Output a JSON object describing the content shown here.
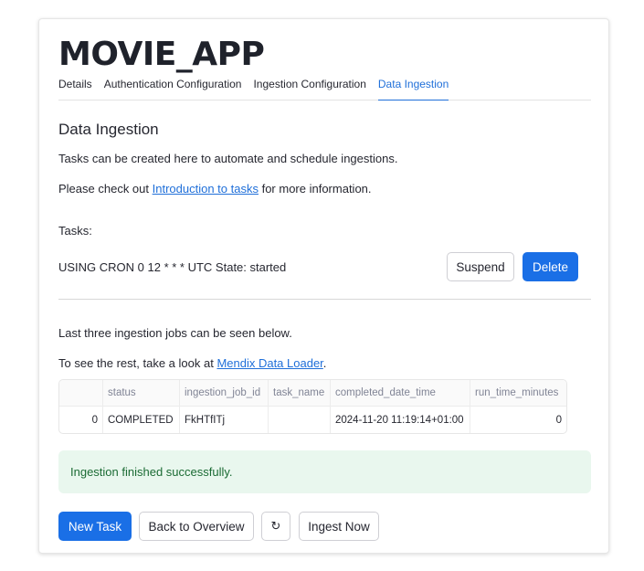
{
  "app": {
    "title": "MOVIE_APP"
  },
  "tabs": [
    {
      "label": "Details"
    },
    {
      "label": "Authentication Configuration"
    },
    {
      "label": "Ingestion Configuration"
    },
    {
      "label": "Data Ingestion",
      "active": true
    }
  ],
  "section": {
    "title": "Data Ingestion",
    "intro": "Tasks can be created here to automate and schedule ingestions.",
    "check_prefix": "Please check out ",
    "check_link": "Introduction to tasks",
    "check_suffix": " for more information."
  },
  "tasks": {
    "label": "Tasks:",
    "items": [
      {
        "text": "USING CRON 0 12 * * * UTC State: started",
        "suspend_label": "Suspend",
        "delete_label": "Delete"
      }
    ]
  },
  "jobs": {
    "intro": "Last three ingestion jobs can be seen below.",
    "rest_prefix": "To see the rest, take a look at ",
    "rest_link": "Mendix Data Loader",
    "rest_suffix": ".",
    "columns": [
      "",
      "status",
      "ingestion_job_id",
      "task_name",
      "completed_date_time",
      "run_time_minutes"
    ],
    "rows": [
      [
        "0",
        "COMPLETED",
        "FkHTfITj",
        "",
        "2024-11-20 11:19:14+01:00",
        "0"
      ]
    ]
  },
  "alert": {
    "message": "Ingestion finished successfully."
  },
  "actions": {
    "new_task": "New Task",
    "back": "Back to Overview",
    "refresh_icon": "↻",
    "ingest": "Ingest Now"
  },
  "colors": {
    "accent": "#1a6fe6",
    "success_bg": "#e9f7ee",
    "success_text": "#1b6b34"
  }
}
